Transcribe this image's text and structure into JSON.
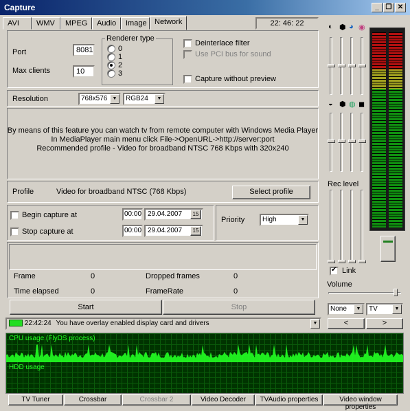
{
  "window": {
    "title": "Capture"
  },
  "tabs": [
    "AVI",
    "WMV",
    "MPEG",
    "Audio",
    "Image",
    "Network"
  ],
  "active_tab": "Network",
  "clock": "22: 46: 22",
  "network": {
    "port_label": "Port",
    "port_value": "8081",
    "max_clients_label": "Max clients",
    "max_clients_value": "10",
    "renderer_title": "Renderer type",
    "renderer_options": [
      "0",
      "1",
      "2",
      "3"
    ],
    "renderer_selected": "2",
    "deinterlace_label": "Deinterlace filter",
    "pci_label": "Use PCI bus for sound",
    "capture_no_preview_label": "Capture without preview"
  },
  "resolution": {
    "label": "Resolution",
    "size": "768x576",
    "format": "RGB24"
  },
  "info": {
    "line1": "By means of this feature you can watch tv from remote computer with  Windows Media Player",
    "line2": "In MediaPlayer main menu click File->OpenURL->http://server:port",
    "line3": "Recommended profile  -  Video for broadband NTSC 768 Kbps with 320x240"
  },
  "profile": {
    "label": "Profile",
    "value": "Video for broadband NTSC (768 Kbps)",
    "button": "Select profile"
  },
  "schedule": {
    "begin_label": "Begin capture at",
    "stop_label": "Stop capture at",
    "begin_time": "00:00",
    "begin_date": "29.04.2007",
    "stop_time": "00:00",
    "stop_date": "29.04.2007",
    "cal_icon": "15",
    "priority_label": "Priority",
    "priority_value": "High"
  },
  "stats": {
    "frame_label": "Frame",
    "frame_value": "0",
    "dropped_label": "Dropped frames",
    "dropped_value": "0",
    "elapsed_label": "Time elapsed",
    "elapsed_value": "0",
    "framerate_label": "FrameRate",
    "framerate_value": "0"
  },
  "controls": {
    "start": "Start",
    "stop": "Stop"
  },
  "status": {
    "time": "22:42:24",
    "message": "You have overlay enabled display card and drivers"
  },
  "graph": {
    "cpu_label": "CPU usage (FlyDS process)",
    "hdd_label": "HDD usage",
    "color": "#22ff22"
  },
  "right": {
    "rec_level": "Rec level",
    "link_label": "Link",
    "volume_label": "Volume",
    "combo1": "None",
    "combo2": "TV",
    "prev": "<",
    "next": ">"
  },
  "bottom_buttons": [
    "TV Tuner",
    "Crossbar",
    "Crossbar 2",
    "Video Decoder",
    "TVAudio properties",
    "Video window properties"
  ],
  "colors": {
    "title_start": "#0a246a",
    "title_end": "#a6caf0",
    "meter_red": "#b01010",
    "meter_yellow": "#a0a020",
    "meter_green": "#109010"
  }
}
